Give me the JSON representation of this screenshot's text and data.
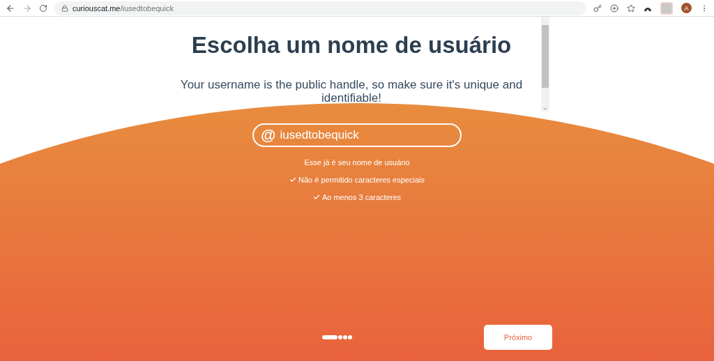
{
  "browser": {
    "url_host": "curiouscat.me",
    "url_path": "/iusedtobequick",
    "avatar": "A"
  },
  "header": {
    "title": "Escolha um nome de usuário",
    "subtitle": "Your username is the public handle, so make sure it's unique and identifiable!"
  },
  "username_field": {
    "prefix": "@",
    "value": "iusedtobequick"
  },
  "messages": [
    {
      "text": "Esse já é seu nome de usuário",
      "checked": false
    },
    {
      "text": "Não é permitido caracteres especiais",
      "checked": true
    },
    {
      "text": "Ao menos 3 caracteres",
      "checked": true
    }
  ],
  "steps": [
    {
      "selected": true
    },
    {
      "selected": false
    },
    {
      "selected": false
    },
    {
      "selected": false
    }
  ],
  "next_button": "Próximo"
}
